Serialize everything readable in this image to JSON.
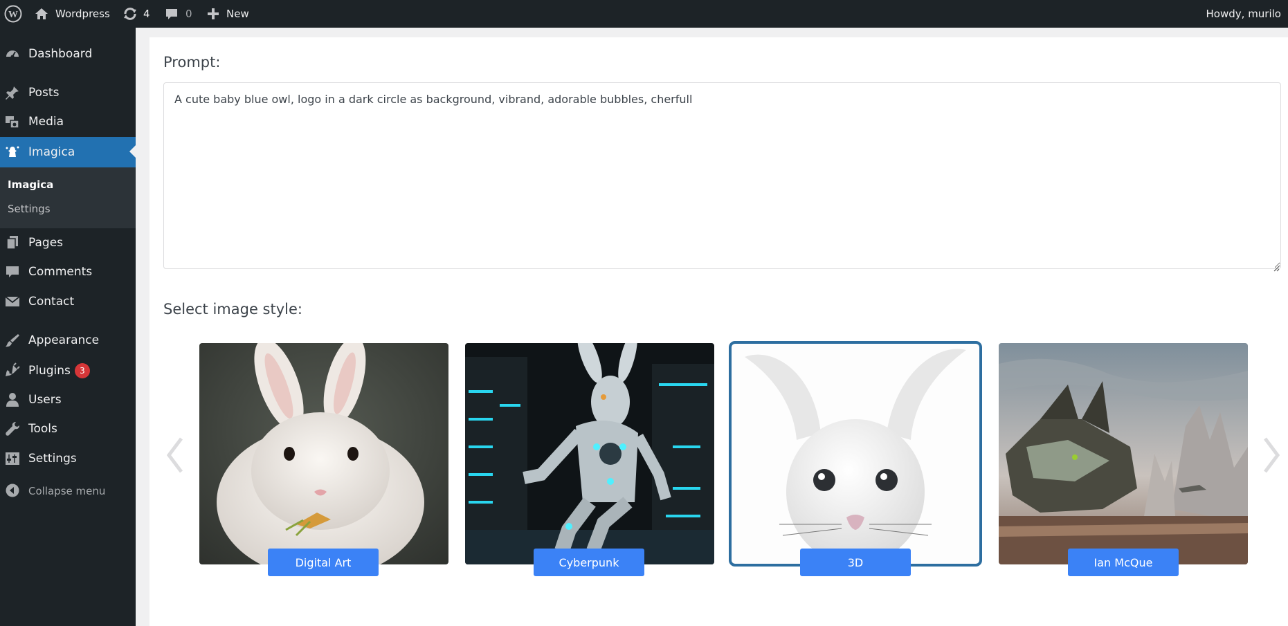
{
  "adminbar": {
    "site_name": "Wordpress",
    "updates_count": "4",
    "comments_count": "0",
    "new_label": "New",
    "greeting": "Howdy, murilo"
  },
  "sidebar": {
    "items": [
      {
        "label": "Dashboard",
        "icon": "dashboard-icon"
      },
      {
        "label": "Posts",
        "icon": "pin-icon"
      },
      {
        "label": "Media",
        "icon": "media-icon"
      },
      {
        "label": "Imagica",
        "icon": "imagica-icon"
      },
      {
        "label": "Pages",
        "icon": "pages-icon"
      },
      {
        "label": "Comments",
        "icon": "comment-icon"
      },
      {
        "label": "Contact",
        "icon": "mail-icon"
      },
      {
        "label": "Appearance",
        "icon": "brush-icon"
      },
      {
        "label": "Plugins",
        "icon": "plugin-icon",
        "badge": "3"
      },
      {
        "label": "Users",
        "icon": "user-icon"
      },
      {
        "label": "Tools",
        "icon": "wrench-icon"
      },
      {
        "label": "Settings",
        "icon": "settings-icon"
      }
    ],
    "submenu": [
      {
        "label": "Imagica"
      },
      {
        "label": "Settings"
      }
    ],
    "collapse_label": "Collapse menu"
  },
  "main": {
    "prompt_heading": "Prompt:",
    "prompt_value": "A cute baby blue owl, logo in a dark circle as background, vibrand, adorable bubbles, cherfull",
    "style_heading": "Select image style:",
    "styles": [
      {
        "label": "Digital Art",
        "selected": false
      },
      {
        "label": "Cyberpunk",
        "selected": false
      },
      {
        "label": "3D",
        "selected": true
      },
      {
        "label": "Ian McQue",
        "selected": false
      }
    ]
  },
  "colors": {
    "admin_bg": "#1d2327",
    "active_menu": "#2271b1",
    "badge": "#d63638",
    "style_button": "#3b82f6",
    "selected_outline": "#2d6ea0"
  }
}
